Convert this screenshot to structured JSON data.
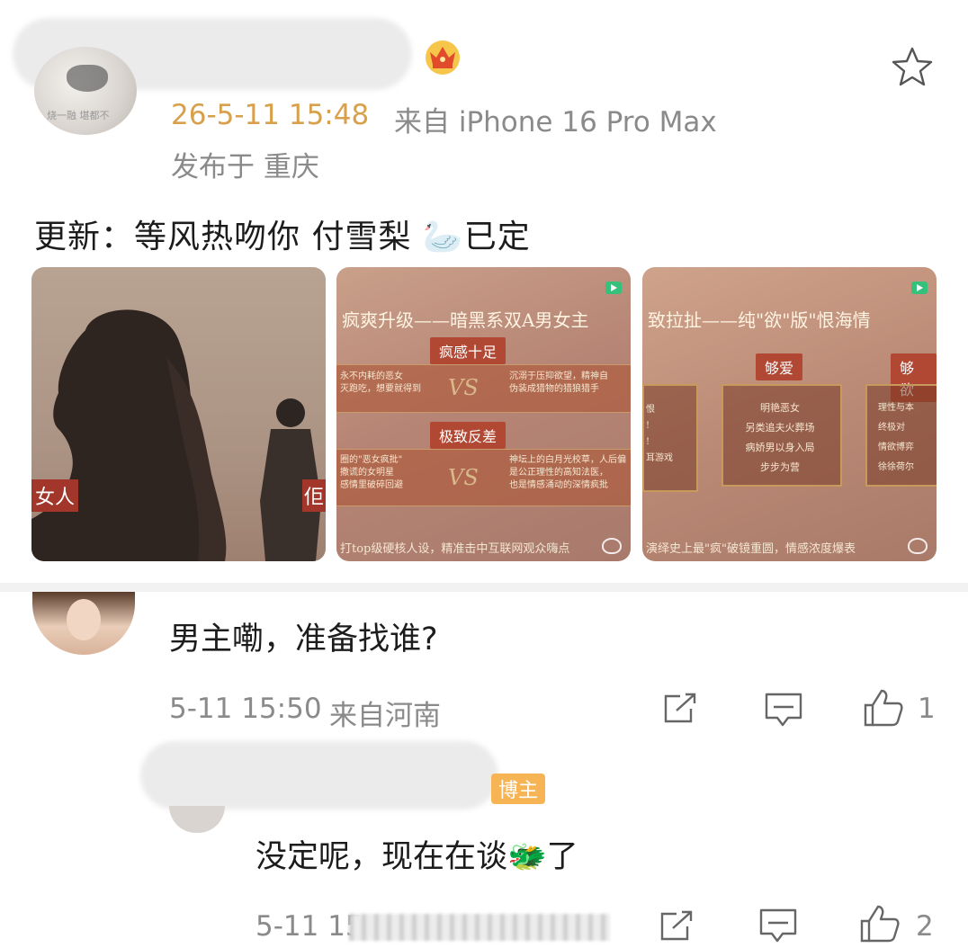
{
  "post": {
    "time": "26-5-11 15:48",
    "source": "来自 iPhone 16 Pro Max",
    "location": "发布于 重庆",
    "text": "更新：等风热吻你 付雪梨 🦢已定",
    "avatar_caption": "烧一融 堪都不"
  },
  "thumbnails": [
    {
      "label": "女人",
      "label2": "佢"
    },
    {
      "title": "疯爽升级——暗黑系双A男女主",
      "tag1": "疯感十足",
      "vs1": "VS",
      "left1": "永不内耗的恶女\n灭跑吃，想要就得到",
      "right1": "沉溺于压抑欲望，精神自\n伪装成猎物的猎狼猎手",
      "tag2": "极致反差",
      "vs2": "VS",
      "left2": "圈的\"恶女疯批\"\n撒谎的女明星\n感情里破碎回避",
      "right2": "神坛上的白月光校草，人后偏\n是公正理性的高知法医，\n也是情感涌动的深情疯批",
      "caption": "打top级硬核人设，精准击中互联网观众嗨点"
    },
    {
      "title": "致拉扯——纯\"欲\"版\"恨海情",
      "tag1": "够爱",
      "tag2": "够欲",
      "col_left": "恨\n!\n!\n耳游戏",
      "col_mid": "明艳恶女\n另类追夫火葬场\n病娇男以身入局\n步步为营",
      "col_right": "理性与本\n终极对\n情欲博弈\n徐徐荷尔",
      "caption": "演绎史上最\"疯\"破镜重圆，情感浓度爆表"
    }
  ],
  "comment1": {
    "text": "男主嘞，准备找谁?",
    "time": "5-11 15:50",
    "source": "来自河南",
    "likes": "1"
  },
  "comment2": {
    "badge": "博主",
    "text": "没定呢，现在在谈🐲了",
    "time": "5-11 15",
    "likes": "2"
  },
  "icons": [
    "crown-badge-icon",
    "star-icon",
    "share-icon",
    "comment-icon",
    "like-icon"
  ]
}
